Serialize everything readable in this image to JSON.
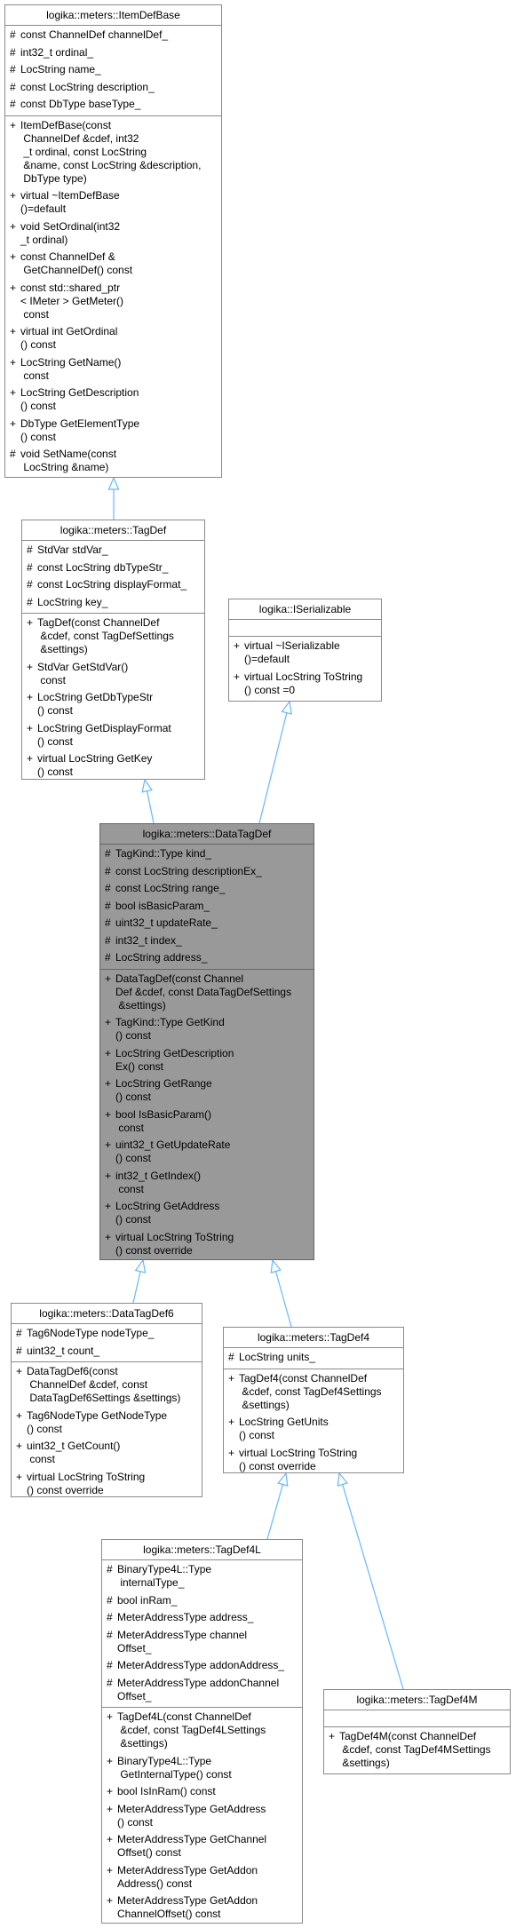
{
  "colors": {
    "edge": "#63b8ff",
    "focus_fill": "#999999",
    "border": "#8a8a8a"
  },
  "classes": [
    {
      "name": "logika::meters::ItemDefBase",
      "attributes": [
        {
          "vis": "#",
          "text": "const ChannelDef channelDef_"
        },
        {
          "vis": "#",
          "text": "int32_t ordinal_"
        },
        {
          "vis": "#",
          "text": "LocString name_"
        },
        {
          "vis": "#",
          "text": "const LocString description_"
        },
        {
          "vis": "#",
          "text": "const DbType baseType_"
        }
      ],
      "methods": [
        {
          "vis": "+",
          "text": "ItemDefBase(const\n ChannelDef &cdef, int32\n _t ordinal, const LocString\n &name, const LocString &description,\n DbType type)"
        },
        {
          "vis": "+",
          "text": "virtual ~ItemDefBase\n()=default"
        },
        {
          "vis": "+",
          "text": "void SetOrdinal(int32\n_t ordinal)"
        },
        {
          "vis": "+",
          "text": "const ChannelDef &\n GetChannelDef() const"
        },
        {
          "vis": "+",
          "text": "const std::shared_ptr\n< IMeter > GetMeter()\n const"
        },
        {
          "vis": "+",
          "text": "virtual int GetOrdinal\n() const"
        },
        {
          "vis": "+",
          "text": "LocString GetName()\n const"
        },
        {
          "vis": "+",
          "text": "LocString GetDescription\n() const"
        },
        {
          "vis": "+",
          "text": "DbType GetElementType\n() const"
        },
        {
          "vis": "#",
          "text": "void SetName(const\n LocString &name)"
        }
      ]
    },
    {
      "name": "logika::meters::TagDef",
      "attributes": [
        {
          "vis": "#",
          "text": "StdVar stdVar_"
        },
        {
          "vis": "#",
          "text": "const LocString dbTypeStr_"
        },
        {
          "vis": "#",
          "text": "const LocString displayFormat_"
        },
        {
          "vis": "#",
          "text": "LocString key_"
        }
      ],
      "methods": [
        {
          "vis": "+",
          "text": "TagDef(const ChannelDef\n &cdef, const TagDefSettings\n &settings)"
        },
        {
          "vis": "+",
          "text": "StdVar GetStdVar()\n const"
        },
        {
          "vis": "+",
          "text": "LocString GetDbTypeStr\n() const"
        },
        {
          "vis": "+",
          "text": "LocString GetDisplayFormat\n() const"
        },
        {
          "vis": "+",
          "text": "virtual LocString GetKey\n() const"
        }
      ]
    },
    {
      "name": "logika::ISerializable",
      "attributes": [],
      "methods": [
        {
          "vis": "+",
          "text": "virtual ~ISerializable\n()=default"
        },
        {
          "vis": "+",
          "text": "virtual LocString ToString\n() const =0"
        }
      ]
    },
    {
      "name": "logika::meters::DataTagDef",
      "attributes": [
        {
          "vis": "#",
          "text": "TagKind::Type kind_"
        },
        {
          "vis": "#",
          "text": "const LocString descriptionEx_"
        },
        {
          "vis": "#",
          "text": "const LocString range_"
        },
        {
          "vis": "#",
          "text": "bool isBasicParam_"
        },
        {
          "vis": "#",
          "text": "uint32_t updateRate_"
        },
        {
          "vis": "#",
          "text": "int32_t index_"
        },
        {
          "vis": "#",
          "text": "LocString address_"
        }
      ],
      "methods": [
        {
          "vis": "+",
          "text": "DataTagDef(const Channel\nDef &cdef, const DataTagDefSettings\n &settings)"
        },
        {
          "vis": "+",
          "text": "TagKind::Type GetKind\n() const"
        },
        {
          "vis": "+",
          "text": "LocString GetDescription\nEx() const"
        },
        {
          "vis": "+",
          "text": "LocString GetRange\n() const"
        },
        {
          "vis": "+",
          "text": "bool IsBasicParam()\n const"
        },
        {
          "vis": "+",
          "text": "uint32_t GetUpdateRate\n() const"
        },
        {
          "vis": "+",
          "text": "int32_t GetIndex()\n const"
        },
        {
          "vis": "+",
          "text": "LocString GetAddress\n() const"
        },
        {
          "vis": "+",
          "text": "virtual LocString ToString\n() const override"
        }
      ]
    },
    {
      "name": "logika::meters::DataTagDef6",
      "attributes": [
        {
          "vis": "#",
          "text": "Tag6NodeType nodeType_"
        },
        {
          "vis": "#",
          "text": "uint32_t count_"
        }
      ],
      "methods": [
        {
          "vis": "+",
          "text": "DataTagDef6(const\n ChannelDef &cdef, const\n DataTagDef6Settings &settings)"
        },
        {
          "vis": "+",
          "text": "Tag6NodeType GetNodeType\n() const"
        },
        {
          "vis": "+",
          "text": "uint32_t GetCount()\n const"
        },
        {
          "vis": "+",
          "text": "virtual LocString ToString\n() const override"
        }
      ]
    },
    {
      "name": "logika::meters::TagDef4",
      "attributes": [
        {
          "vis": "#",
          "text": "LocString units_"
        }
      ],
      "methods": [
        {
          "vis": "+",
          "text": "TagDef4(const ChannelDef\n &cdef, const TagDef4Settings\n &settings)"
        },
        {
          "vis": "+",
          "text": "LocString GetUnits\n() const"
        },
        {
          "vis": "+",
          "text": "virtual LocString ToString\n() const override"
        }
      ]
    },
    {
      "name": "logika::meters::TagDef4L",
      "attributes": [
        {
          "vis": "#",
          "text": "BinaryType4L::Type\n internalType_"
        },
        {
          "vis": "#",
          "text": "bool inRam_"
        },
        {
          "vis": "#",
          "text": "MeterAddressType address_"
        },
        {
          "vis": "#",
          "text": "MeterAddressType channel\nOffset_"
        },
        {
          "vis": "#",
          "text": "MeterAddressType addonAddress_"
        },
        {
          "vis": "#",
          "text": "MeterAddressType addonChannel\nOffset_"
        }
      ],
      "methods": [
        {
          "vis": "+",
          "text": "TagDef4L(const ChannelDef\n &cdef, const TagDef4LSettings\n &settings)"
        },
        {
          "vis": "+",
          "text": "BinaryType4L::Type\n GetInternalType() const"
        },
        {
          "vis": "+",
          "text": "bool IsInRam() const"
        },
        {
          "vis": "+",
          "text": "MeterAddressType GetAddress\n() const"
        },
        {
          "vis": "+",
          "text": "MeterAddressType GetChannel\nOffset() const"
        },
        {
          "vis": "+",
          "text": "MeterAddressType GetAddon\nAddress() const"
        },
        {
          "vis": "+",
          "text": "MeterAddressType GetAddon\nChannelOffset() const"
        }
      ]
    },
    {
      "name": "logika::meters::TagDef4M",
      "attributes": [],
      "methods": [
        {
          "vis": "+",
          "text": "TagDef4M(const ChannelDef\n &cdef, const TagDef4MSettings\n &settings)"
        }
      ]
    }
  ],
  "inheritance": [
    {
      "child": "logika::meters::TagDef",
      "parent": "logika::meters::ItemDefBase"
    },
    {
      "child": "logika::meters::DataTagDef",
      "parent": "logika::meters::TagDef"
    },
    {
      "child": "logika::meters::DataTagDef",
      "parent": "logika::ISerializable"
    },
    {
      "child": "logika::meters::DataTagDef6",
      "parent": "logika::meters::DataTagDef"
    },
    {
      "child": "logika::meters::TagDef4",
      "parent": "logika::meters::DataTagDef"
    },
    {
      "child": "logika::meters::TagDef4L",
      "parent": "logika::meters::TagDef4"
    },
    {
      "child": "logika::meters::TagDef4M",
      "parent": "logika::meters::TagDef4"
    }
  ]
}
